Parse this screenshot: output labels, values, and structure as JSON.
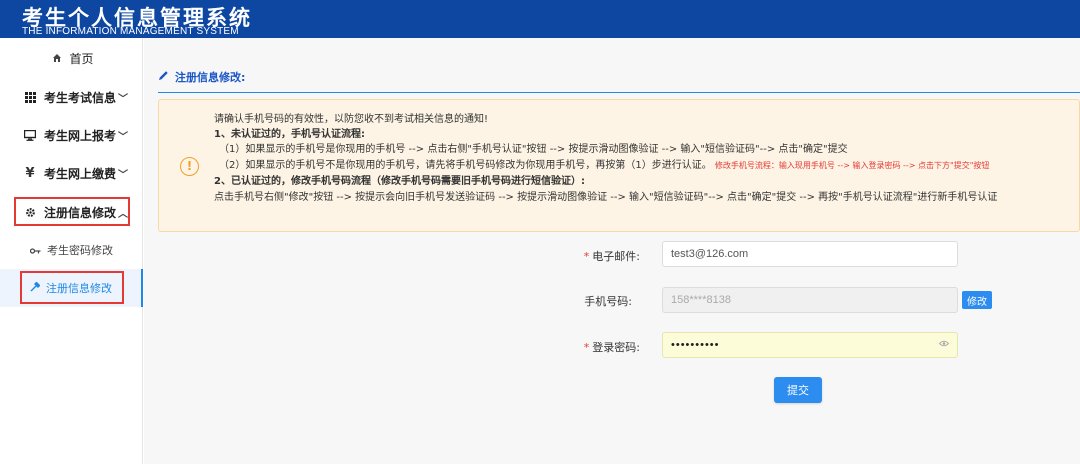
{
  "header": {
    "title": "考生个人信息管理系统",
    "subtitle": "THE INFORMATION MANAGEMENT SYSTEM"
  },
  "sidebar": {
    "home": {
      "label": "首页",
      "icon": "home-icon"
    },
    "items": [
      {
        "label": "考生考试信息",
        "icon": "grid-icon",
        "chevron": "﹀"
      },
      {
        "label": "考生网上报考",
        "icon": "monitor-icon",
        "chevron": "﹀"
      },
      {
        "label": "考生网上缴费",
        "icon": "yen-icon",
        "chevron": "﹀"
      },
      {
        "label": "注册信息修改",
        "icon": "gear-icon",
        "chevron": "︿"
      }
    ],
    "sub_items": [
      {
        "label": "考生密码修改",
        "icon": "key-icon"
      },
      {
        "label": "注册信息修改",
        "icon": "wrench-icon"
      }
    ]
  },
  "main": {
    "section_title": "注册信息修改:",
    "notice": {
      "icon": "warning-icon",
      "line1": "请确认手机号码的有效性，以防您收不到考试相关信息的通知!",
      "line2": "1、未认证过的，手机号认证流程:",
      "line3": "（1）如果显示的手机号是你现用的手机号 --> 点击右侧\"手机号认证\"按钮 --> 按提示滑动图像验证 --> 输入\"短信验证码\"--> 点击\"确定\"提交",
      "line4": "（2）如果显示的手机号不是你现用的手机号，请先将手机号码修改为你现用手机号，再按第（1）步进行认证。",
      "line4_red": "修改手机号流程：输入现用手机号 --> 输入登录密码 --> 点击下方\"提交\"按钮",
      "line5": "2、已认证过的，修改手机号码流程（修改手机号码需要旧手机号码进行短信验证）:",
      "line6": "点击手机号右侧\"修改\"按钮 --> 按提示会向旧手机号发送验证码 --> 按提示滑动图像验证 --> 输入\"短信验证码\"--> 点击\"确定\"提交 --> 再按\"手机号认证流程\"进行新手机号认证"
    },
    "form": {
      "email_label": "电子邮件:",
      "email_value": "test3@126.com",
      "phone_label": "手机号码:",
      "phone_value": "158****8138",
      "modify_button": "修改",
      "password_label": "登录密码:",
      "password_value": "••••••••••",
      "required_mark": "*",
      "submit_button": "提交"
    }
  },
  "colors": {
    "header_bg": "#0d47a1",
    "accent": "#1e88e5",
    "button": "#2d8cf0",
    "highlight_box": "#e53935",
    "notice_bg": "#fdf4e5",
    "warning": "#f0a02a"
  }
}
